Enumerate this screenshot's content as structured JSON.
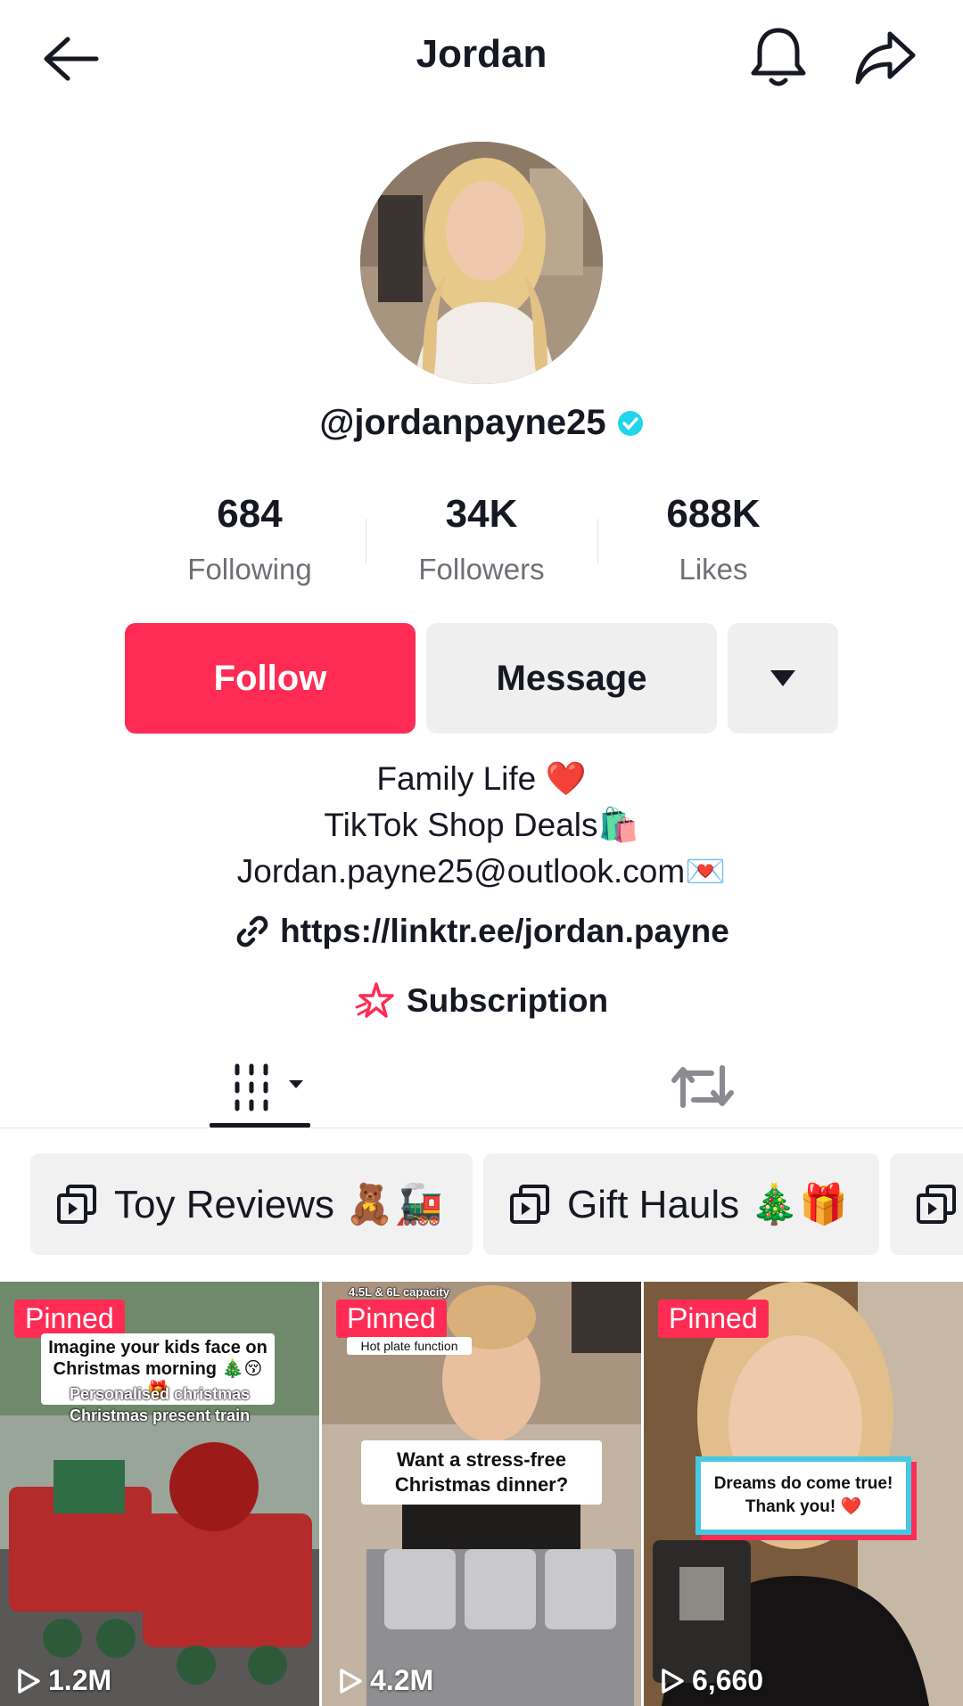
{
  "header": {
    "title": "Jordan",
    "back_icon": "arrow-left-icon",
    "bell_icon": "bell-icon",
    "share_icon": "share-arrow-icon"
  },
  "profile": {
    "handle": "@jordanpayne25",
    "verified": true,
    "verified_color": "#20d5ec"
  },
  "stats": [
    {
      "value": "684",
      "label": "Following"
    },
    {
      "value": "34K",
      "label": "Followers"
    },
    {
      "value": "688K",
      "label": "Likes"
    }
  ],
  "actions": {
    "follow_label": "Follow",
    "message_label": "Message",
    "follow_color": "#fe2c55"
  },
  "bio": {
    "lines": [
      "Family Life ❤️",
      "TikTok Shop Deals🛍️",
      "Jordan.payne25@outlook.com💌"
    ],
    "link": "https://linktr.ee/jordan.payne",
    "subscription_label": "Subscription"
  },
  "tabs": [
    {
      "name": "videos",
      "icon": "grid-icon",
      "active": true
    },
    {
      "name": "reposts",
      "icon": "repost-icon",
      "active": false
    }
  ],
  "playlists": [
    {
      "label": "Toy Reviews 🧸🚂",
      "icon": "playlist-icon"
    },
    {
      "label": "Gift Hauls 🎄🎁",
      "icon": "playlist-icon"
    },
    {
      "label": "",
      "icon": "playlist-icon"
    }
  ],
  "videos": [
    {
      "pinned_label": "Pinned",
      "views": "1.2M",
      "caption": "Imagine your kids face on Christmas morning 🎄😚🎁",
      "overlay_1": "Personalised christmas",
      "overlay_2": "Christmas present train"
    },
    {
      "pinned_label": "Pinned",
      "views": "4.2M",
      "top_text": "4.5L & 6L capacity",
      "small_caption": "Hot plate function",
      "caption": "Want a stress-free Christmas dinner?"
    },
    {
      "pinned_label": "Pinned",
      "views": "6,660",
      "caption": "Dreams do come true! Thank you! ❤️"
    }
  ]
}
